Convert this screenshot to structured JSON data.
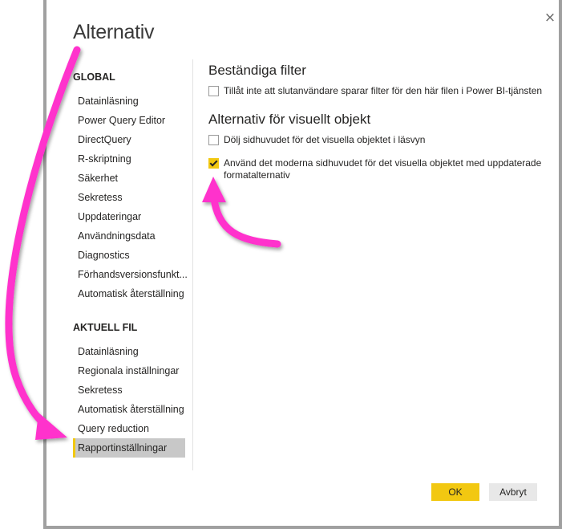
{
  "dialog": {
    "title": "Alternativ",
    "close_icon": "×"
  },
  "sidebar": {
    "global_heading": "GLOBAL",
    "global_items": [
      {
        "label": "Datainläsning"
      },
      {
        "label": "Power Query Editor"
      },
      {
        "label": "DirectQuery"
      },
      {
        "label": "R-skriptning"
      },
      {
        "label": "Säkerhet"
      },
      {
        "label": "Sekretess"
      },
      {
        "label": "Uppdateringar"
      },
      {
        "label": "Användningsdata"
      },
      {
        "label": "Diagnostics"
      },
      {
        "label": "Förhandsversionsfunkt..."
      },
      {
        "label": "Automatisk återställning"
      }
    ],
    "file_heading": "AKTUELL FIL",
    "file_items": [
      {
        "label": "Datainläsning"
      },
      {
        "label": "Regionala inställningar"
      },
      {
        "label": "Sekretess"
      },
      {
        "label": "Automatisk återställning"
      },
      {
        "label": "Query reduction"
      },
      {
        "label": "Rapportinställningar",
        "selected": true
      }
    ]
  },
  "content": {
    "section1_title": "Beständiga filter",
    "option1": {
      "label": "Tillåt inte att slutanvändare sparar filter för den här filen i Power BI-tjänsten",
      "checked": false
    },
    "section2_title": "Alternativ för visuellt objekt",
    "option2": {
      "label": "Dölj sidhuvudet för det visuella objektet i läsvyn",
      "checked": false
    },
    "option3": {
      "label": "Använd det moderna sidhuvudet för det visuella objektet med uppdaterade formatalternativ",
      "checked": true
    }
  },
  "buttons": {
    "ok": "OK",
    "cancel": "Avbryt"
  },
  "colors": {
    "accent": "#f2c811",
    "annotation_arrow": "#ff33cc",
    "selected_bg": "#c8c8c8"
  }
}
